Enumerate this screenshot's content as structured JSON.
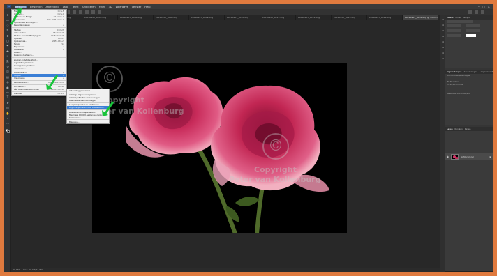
{
  "menubar": {
    "items": [
      "Bestand",
      "Bewerken",
      "Afbeelding",
      "Laag",
      "Tekst",
      "Selecteren",
      "Filter",
      "3D",
      "Weergave",
      "Venster",
      "Help"
    ],
    "active_index": 0
  },
  "tabs": [
    "20190107_0002.dng",
    "20190107_0004.dng",
    "20190107_0005.dng",
    "20190107_0006.dng",
    "20190107_0008.dng",
    "20190107_0009.dng",
    "20190107_0010.dng",
    "20190107_0011.dng",
    "20190107_0012.dng",
    "20190107_0013.dng",
    "20190107_0014.dng",
    "20190107_0016.dng @ 33,3% (RGB/8)"
  ],
  "file_menu": {
    "items": [
      {
        "label": "Nieuw...",
        "shortcut": "Ctrl+N"
      },
      {
        "label": "Openen...",
        "shortcut": "Ctrl+O"
      },
      {
        "label": "Bladeren in Bridge...",
        "shortcut": "Alt+Ctrl+O"
      },
      {
        "label": "Openen als...",
        "shortcut": "Alt+Shift+Ctrl+O"
      },
      {
        "label": "Openen als slim object...",
        "shortcut": ""
      },
      {
        "label": "Recente openen",
        "shortcut": "▸"
      },
      {
        "sep": true
      },
      {
        "label": "Sluiten",
        "shortcut": "Ctrl+W"
      },
      {
        "label": "Alles sluiten",
        "shortcut": "Alt+Ctrl+W"
      },
      {
        "label": "Sluiten en naar Bridge gaan...",
        "shortcut": "Shift+Ctrl+W"
      },
      {
        "label": "Opslaan",
        "shortcut": "Ctrl+S"
      },
      {
        "label": "Opslaan als...",
        "shortcut": "Shift+Ctrl+S"
      },
      {
        "label": "Terug",
        "shortcut": "F12"
      },
      {
        "label": "Exporteren",
        "shortcut": "▸"
      },
      {
        "label": "Genereren",
        "shortcut": "▸"
      },
      {
        "label": "Delen...",
        "shortcut": ""
      },
      {
        "label": "Delen op Behance...",
        "shortcut": ""
      },
      {
        "sep": true
      },
      {
        "label": "Zoeken in Adobe Stock...",
        "shortcut": ""
      },
      {
        "label": "Ingesloten plaatsen...",
        "shortcut": ""
      },
      {
        "label": "Gekoppelde plaatsen...",
        "shortcut": ""
      },
      {
        "label": "Verpakken...",
        "shortcut": "",
        "disabled": true
      },
      {
        "sep": true
      },
      {
        "label": "Automatisch",
        "shortcut": "▸"
      },
      {
        "label": "Scripts",
        "shortcut": "▸",
        "highlight": true
      },
      {
        "label": "Importeren",
        "shortcut": "▸"
      },
      {
        "sep": true
      },
      {
        "label": "Bestandsinfo...",
        "shortcut": "Alt+Shift+Ctrl+I"
      },
      {
        "sep": true
      },
      {
        "label": "Afdrukken...",
        "shortcut": "Ctrl+P"
      },
      {
        "label": "Eén exemplaar afdrukken",
        "shortcut": "Alt+Shift+Ctrl+P"
      },
      {
        "sep": true
      },
      {
        "label": "Afsluiten",
        "shortcut": "Ctrl+Q"
      }
    ]
  },
  "scripts_menu": {
    "items": [
      {
        "label": "Afbeeldingsprocessor...",
        "shortcut": ""
      },
      {
        "sep": true
      },
      {
        "label": "Alle lege lagen verwijderen",
        "shortcut": ""
      },
      {
        "label": "Alle laageffecten samenvoegen",
        "shortcut": ""
      },
      {
        "label": "Alle maskers samenvoegen",
        "shortcut": ""
      },
      {
        "sep": true
      },
      {
        "label": "Laagcomposities in bestanden...",
        "shortcut": ""
      },
      {
        "label": "Lagen exporteren naar bestanden...",
        "shortcut": "",
        "highlight": true
      },
      {
        "sep": true
      },
      {
        "label": "Bestanden in stapel laden...",
        "shortcut": ""
      },
      {
        "label": "Meerdere DICOM-bestanden laden...",
        "shortcut": ""
      },
      {
        "label": "Statistieken...",
        "shortcut": ""
      },
      {
        "sep": true
      },
      {
        "label": "Bladeren...",
        "shortcut": ""
      }
    ]
  },
  "watermark": {
    "symbol": "©",
    "line1": "Copyright",
    "line2": "Peter van Kollenburg"
  },
  "statusbar": {
    "zoom": "33,33%",
    "info": "Doc: 41,9M/41,9M"
  },
  "right_panel": {
    "top_tabs": [
      "Tekens",
      "Alinea",
      "Glyphs"
    ],
    "mid_tabs": [
      "Eigenschappen",
      "Aanpassingen",
      "Laagcomposities"
    ],
    "mid_title": "Documenteigenschappen",
    "mid_w_label": "B: 30 inches",
    "mid_h_label": "H: 20,023 inches",
    "mid_res_label": "Resolutie: 300 pixels/inch",
    "layers_tabs": [
      "Lagen",
      "Kanalen",
      "Paden"
    ],
    "layer_name": "Achtergrond"
  },
  "colors": {
    "accent": "#3a7fd6",
    "arrow": "#19c43b",
    "frame": "#e07a3e",
    "rose": "#d6396a"
  }
}
